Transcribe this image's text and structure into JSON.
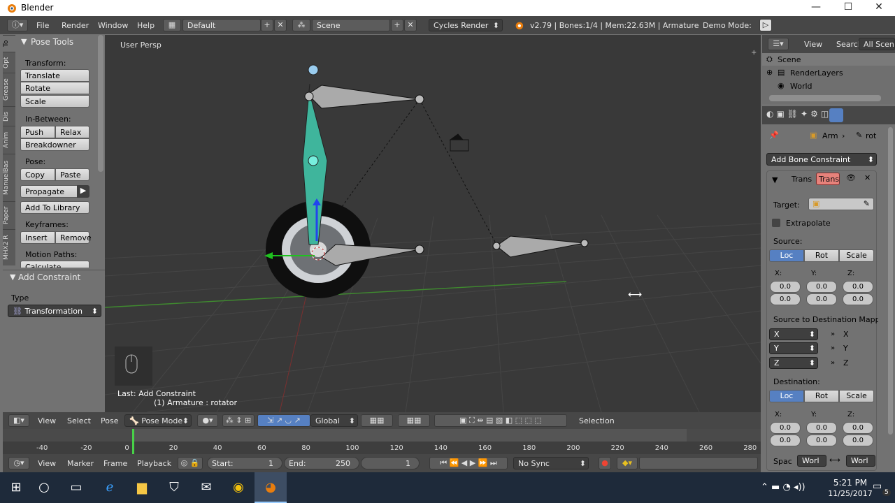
{
  "window": {
    "title": "Blender",
    "minimize": "—",
    "maximize": "☐",
    "close": "✕"
  },
  "info_header": {
    "menus": [
      "File",
      "Render",
      "Window",
      "Help"
    ],
    "layout": "Default",
    "scene": "Scene",
    "engine": "Cycles Render",
    "stats": "v2.79 | Bones:1/4 | Mem:22.63M | Armature",
    "demo_mode": "Demo Mode:"
  },
  "toolshelf": {
    "tabs": [
      "To",
      "Opt",
      "Grease",
      "Dis",
      "Anim",
      "ManuelBas",
      "Paper",
      "MHX2 R"
    ],
    "panel_title": "Pose Tools",
    "transform_label": "Transform:",
    "translate": "Translate",
    "rotate": "Rotate",
    "scale": "Scale",
    "inbetween_label": "In-Between:",
    "push": "Push",
    "relax": "Relax",
    "breakdowner": "Breakdowner",
    "pose_label": "Pose:",
    "copy": "Copy",
    "paste": "Paste",
    "propagate": "Propagate",
    "add_to_library": "Add To Library",
    "keyframes_label": "Keyframes:",
    "insert": "Insert",
    "remove": "Remove",
    "motion_paths_label": "Motion Paths:",
    "calculate": "Calculate"
  },
  "operator_panel": {
    "title": "Add Constraint",
    "type_label": "Type",
    "type_value": "Transformation"
  },
  "viewport": {
    "view_name": "User Persp",
    "last_op": "Last: Add Constraint",
    "object_info": "(1) Armature : rotator"
  },
  "viewport_header": {
    "view": "View",
    "select": "Select",
    "pose": "Pose",
    "mode": "Pose Mode",
    "orientation": "Global",
    "selection": "Selection"
  },
  "timeline": {
    "ticks": [
      "-40",
      "-20",
      "0",
      "20",
      "40",
      "60",
      "80",
      "100",
      "120",
      "140",
      "160",
      "180",
      "200",
      "220",
      "240",
      "260",
      "280"
    ],
    "menus": [
      "View",
      "Marker",
      "Frame",
      "Playback"
    ],
    "start_label": "Start:",
    "start_value": "1",
    "end_label": "End:",
    "end_value": "250",
    "current_frame": "1",
    "sync": "No Sync"
  },
  "outliner": {
    "view": "View",
    "search": "Search",
    "filter": "All Scene",
    "items": [
      "Scene",
      "RenderLayers",
      "World"
    ]
  },
  "properties": {
    "breadcrumb_arm": "Arm",
    "breadcrumb_rot": "rot",
    "add_bone_constraint": "Add Bone Constraint",
    "constraint_type_short": "Trans",
    "constraint_name": "Trans",
    "target_label": "Target:",
    "extrapolate": "Extrapolate",
    "source_label": "Source:",
    "loc": "Loc",
    "rot": "Rot",
    "scale": "Scale",
    "x_label": "X:",
    "y_label": "Y:",
    "z_label": "Z:",
    "zero": "0.0",
    "mapping_label": "Source to Destination Mappi...",
    "map_x": "X",
    "map_y": "Y",
    "map_z": "Z",
    "arrow": "»",
    "destination_label": "Destination:",
    "space_label": "Spac",
    "space_a": "Worl",
    "space_b": "Worl"
  },
  "taskbar": {
    "time": "5:21 PM",
    "date": "11/25/2017",
    "notif_count": "5"
  }
}
